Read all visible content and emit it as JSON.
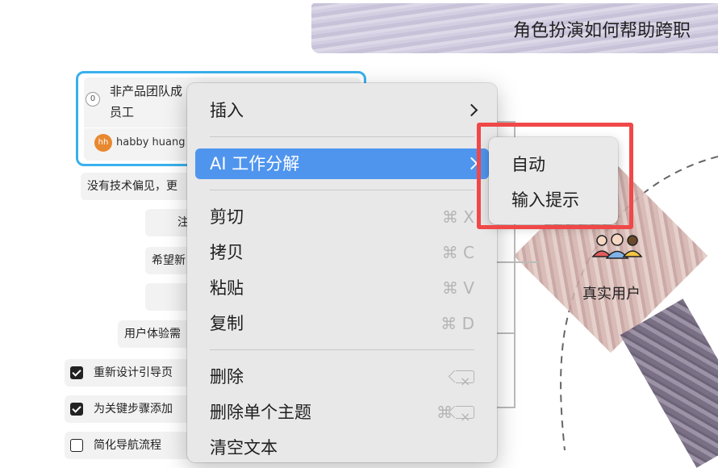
{
  "title": "角色扮演如何帮助跨职",
  "node": {
    "index": "0",
    "title": "非产品团队成员工",
    "title_line1": "非产品团队成",
    "title_line2": "员工",
    "avatar_initials": "hh",
    "author": "habby huang"
  },
  "outline_rows": [
    {
      "text": "没有技术偏见，更",
      "checkbox": "none"
    },
    {
      "text": "注",
      "checkbox": "none"
    },
    {
      "text": "希望新",
      "checkbox": "none"
    },
    {
      "text": "",
      "checkbox": "none"
    },
    {
      "text": "用户体验需",
      "checkbox": "none"
    },
    {
      "text": "重新设计引导页",
      "checkbox": "checked"
    },
    {
      "text": "为关键步骤添加",
      "checkbox": "checked"
    },
    {
      "text": "简化导航流程",
      "checkbox": "unchecked"
    }
  ],
  "context_menu": {
    "items": [
      {
        "label": "插入",
        "shortcut": "",
        "submenu": true
      },
      {
        "label": "AI 工作分解",
        "shortcut": "",
        "submenu": true,
        "active": true
      },
      {
        "label": "剪切",
        "shortcut": "⌘ X"
      },
      {
        "label": "拷贝",
        "shortcut": "⌘ C"
      },
      {
        "label": "粘贴",
        "shortcut": "⌘ V"
      },
      {
        "label": "复制",
        "shortcut": "⌘ D"
      },
      {
        "label": "删除",
        "shortcut": "delete-key"
      },
      {
        "label": "删除单个主题",
        "shortcut": "⌘"
      },
      {
        "label": "清空文本",
        "shortcut": ""
      }
    ]
  },
  "submenu": {
    "items": [
      "自动",
      "输入提示"
    ]
  },
  "diagram": {
    "people_label": "真实用户",
    "people_icon": "users-group-icon"
  },
  "colors": {
    "accent": "#4f95ee",
    "selection_border": "#3ab0ec",
    "highlight": "#f04848",
    "avatar": "#e8882f"
  }
}
